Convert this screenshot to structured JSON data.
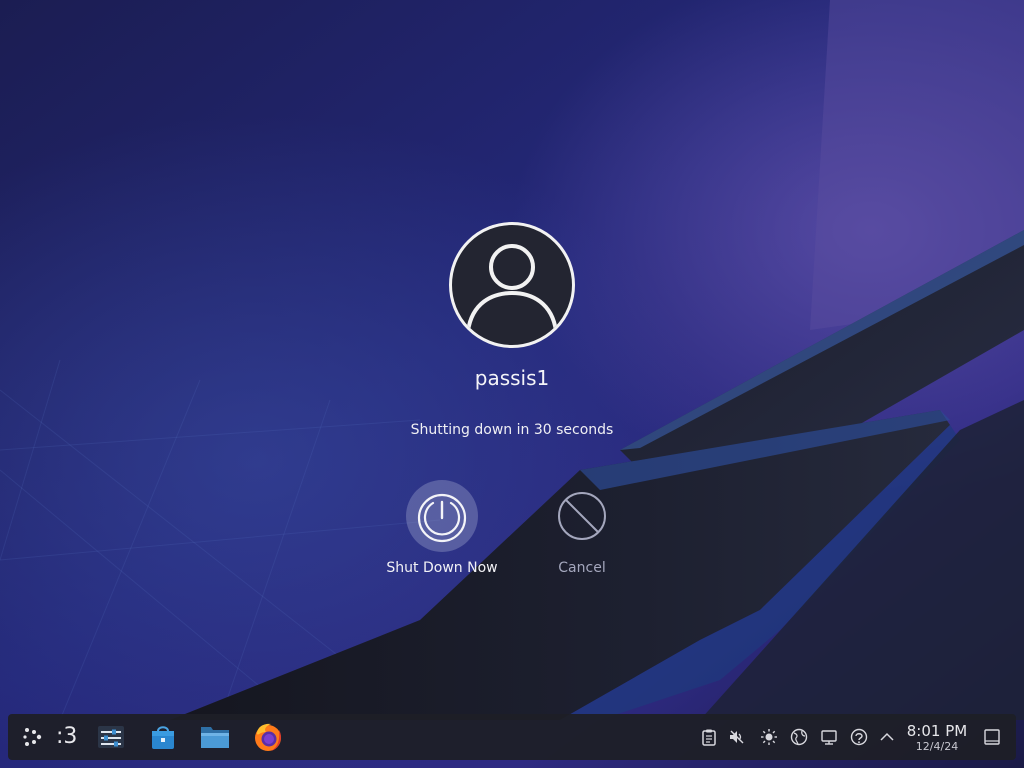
{
  "logout_dialog": {
    "username": "passis1",
    "status_text": "Shutting down in 30 seconds",
    "actions": [
      {
        "label": "Shut Down Now",
        "icon": "power-icon"
      },
      {
        "label": "Cancel",
        "icon": "cancel-icon"
      }
    ]
  },
  "taskbar": {
    "virtual_desktop_label": ":3",
    "pinned_apps": [
      {
        "name": "System Settings",
        "icon": "settings-sliders-icon"
      },
      {
        "name": "Discover",
        "icon": "store-bag-icon"
      },
      {
        "name": "Dolphin",
        "icon": "folder-icon"
      },
      {
        "name": "Firefox",
        "icon": "firefox-icon"
      }
    ],
    "tray_icons": [
      "clipboard-icon",
      "volume-muted-icon",
      "brightness-icon",
      "network-globe-icon",
      "display-icon",
      "update-icon",
      "chevron-up-icon"
    ],
    "clock": {
      "time": "8:01 PM",
      "date": "12/4/24"
    }
  },
  "colors": {
    "wallpaper_base": "#1a1c52",
    "wallpaper_purple": "#5a4a9e",
    "ribbon_dark": "#14161e",
    "ribbon_edge": "#2f4e98",
    "taskbar_bg": "#1e1f26",
    "accent_blue": "#3d8fd1"
  }
}
